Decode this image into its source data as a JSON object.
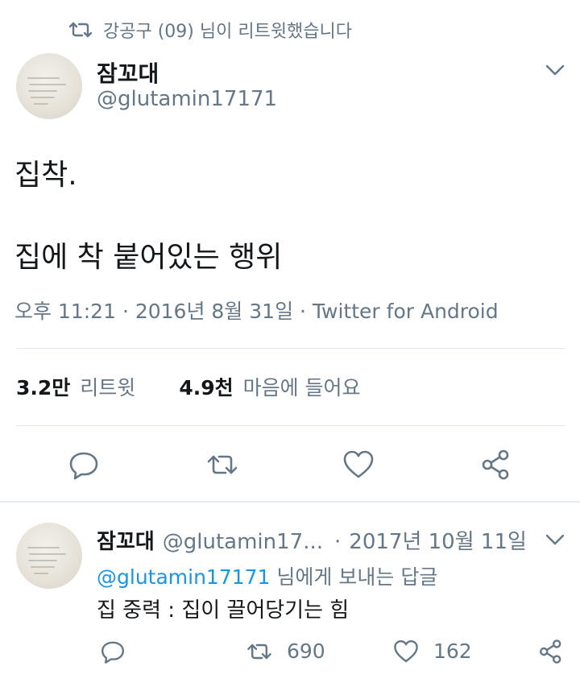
{
  "retweet_header": {
    "text": "강공구 (09) 님이 리트윗했습니다",
    "icon": "retweet-icon"
  },
  "main_tweet": {
    "display_name": "잠꼬대",
    "handle": "@glutamin17171",
    "lines": [
      "집착.",
      "집에 착 붙어있는 행위"
    ],
    "meta": "오후 11:21 · 2016년 8월 31일 · Twitter for Android",
    "stats": {
      "retweets_count": "3.2만",
      "retweets_label": "리트윗",
      "likes_count": "4.9천",
      "likes_label": "마음에 들어요"
    },
    "actions": [
      "reply-icon",
      "retweet-icon",
      "like-icon",
      "share-icon"
    ]
  },
  "reply": {
    "display_name": "잠꼬대",
    "handle": "@glutamin17...",
    "separator": "·",
    "date": "2017년 10월 11일",
    "reply_to_handle": "@glutamin17171",
    "reply_to_suffix": "님에게 보내는 답글",
    "text": "집 중력 : 집이 끌어당기는 힘",
    "retweet_count": "690",
    "like_count": "162",
    "actions": [
      "reply-icon",
      "retweet-icon",
      "like-icon",
      "share-icon"
    ]
  },
  "colors": {
    "text": "#14171a",
    "secondary": "#657786",
    "link": "#1b95e0",
    "divider": "#e1e8ed"
  }
}
